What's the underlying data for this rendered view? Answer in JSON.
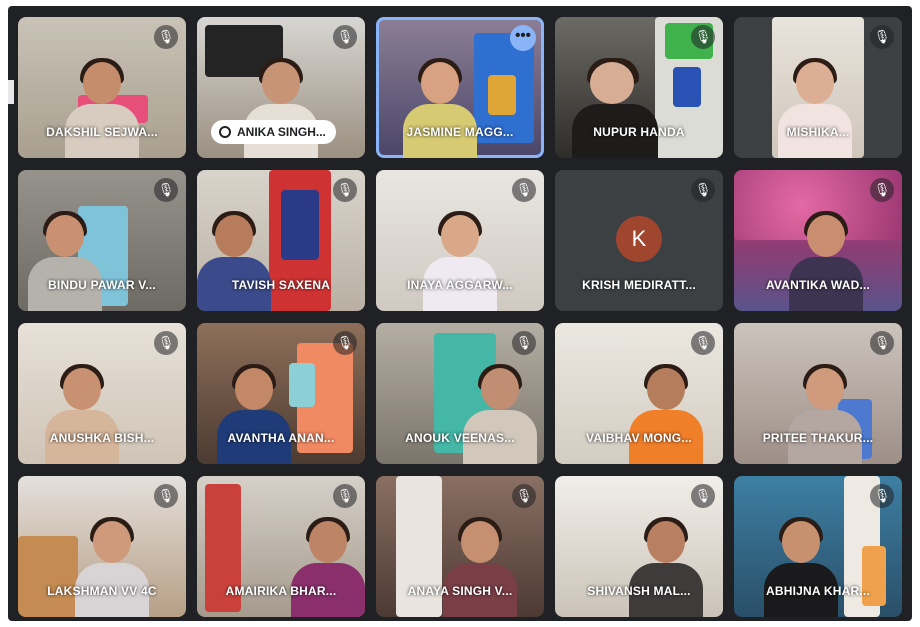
{
  "meeting": {
    "accent_color": "#8ab4f8",
    "avatar_color": "#a0452e",
    "participants": [
      {
        "name": "DAKSHIL SEJWA...",
        "mic": "muted"
      },
      {
        "name": "ANIKA SINGH...",
        "mic": "muted"
      },
      {
        "name": "JASMINE MAGG...",
        "mic": "more-options",
        "more_label": "•••"
      },
      {
        "name": "NUPUR HANDA",
        "mic": "muted"
      },
      {
        "name": "MISHIKA...",
        "mic": "muted"
      },
      {
        "name": "BINDU PAWAR V...",
        "mic": "muted"
      },
      {
        "name": "TAVISH SAXENA",
        "mic": "muted"
      },
      {
        "name": "INAYA AGGARW...",
        "mic": "muted"
      },
      {
        "name": "KRISH MEDIRATT...",
        "mic": "muted",
        "avatar_letter": "K"
      },
      {
        "name": "AVANTIKA WAD...",
        "mic": "muted"
      },
      {
        "name": "ANUSHKA BISH...",
        "mic": "muted"
      },
      {
        "name": "AVANTHA ANAN...",
        "mic": "muted"
      },
      {
        "name": "ANOUK VEENAS...",
        "mic": "muted"
      },
      {
        "name": "VAIBHAV MONG...",
        "mic": "muted"
      },
      {
        "name": "PRITEE THAKUR...",
        "mic": "muted"
      },
      {
        "name": "LAKSHMAN VV 4C",
        "mic": "muted"
      },
      {
        "name": "AMAIRIKA BHAR...",
        "mic": "muted"
      },
      {
        "name": "ANAYA SINGH V...",
        "mic": "muted"
      },
      {
        "name": "SHIVANSH MAL...",
        "mic": "muted"
      },
      {
        "name": "ABHIJNA KHAR...",
        "mic": "muted"
      }
    ],
    "muted_icon": "🎙",
    "pill_icon": "mic-muted-icon"
  }
}
